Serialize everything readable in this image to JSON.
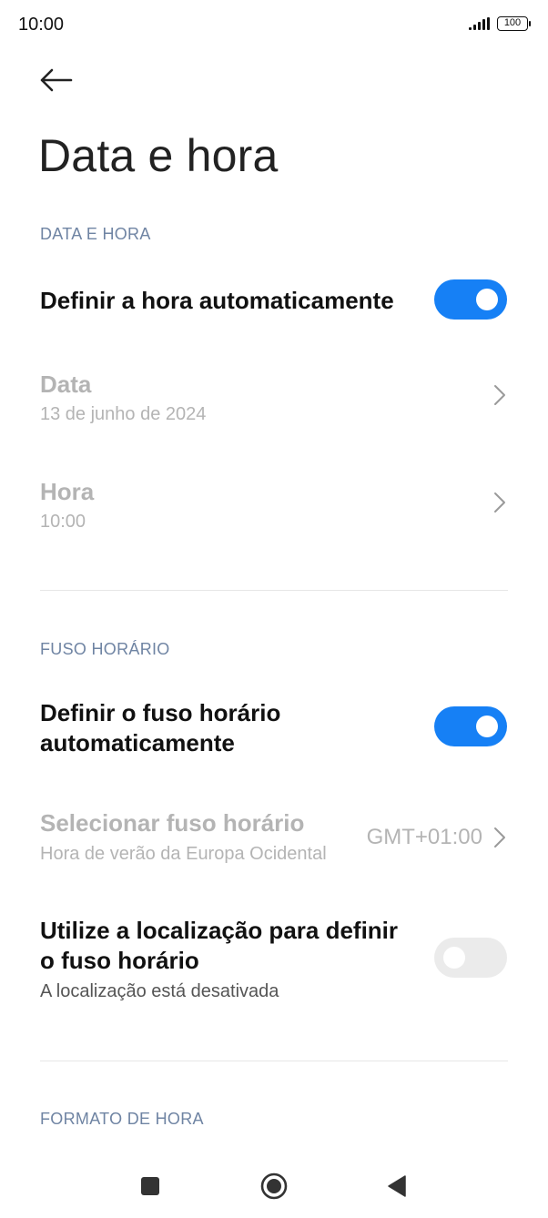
{
  "status_bar": {
    "time": "10:00",
    "battery": "100"
  },
  "header": {
    "title": "Data e hora"
  },
  "sections": {
    "date_time": {
      "header": "DATA E HORA",
      "auto_time": {
        "label": "Definir a hora automaticamente",
        "enabled": true
      },
      "date": {
        "label": "Data",
        "value": "13 de junho de 2024"
      },
      "time": {
        "label": "Hora",
        "value": "10:00"
      }
    },
    "timezone": {
      "header": "FUSO HORÁRIO",
      "auto_timezone": {
        "label_line1": "Definir o fuso horário",
        "label_line2": "automaticamente",
        "enabled": true
      },
      "select_timezone": {
        "label": "Selecionar fuso horário",
        "subtitle": "Hora de verão da Europa Ocidental",
        "value": "GMT+01:00"
      },
      "use_location": {
        "label_line1": "Utilize a localização para definir",
        "label_line2": "o fuso horário",
        "subtitle": "A localização está desativada",
        "enabled": false
      }
    },
    "time_format": {
      "header": "FORMATO DE HORA"
    }
  },
  "colors": {
    "accent": "#1680f5",
    "section_header": "#6f84a3",
    "disabled_text": "#b4b4b4"
  },
  "navigation": {
    "icons": [
      "recent-apps-icon",
      "home-icon",
      "back-triangle-icon"
    ]
  }
}
